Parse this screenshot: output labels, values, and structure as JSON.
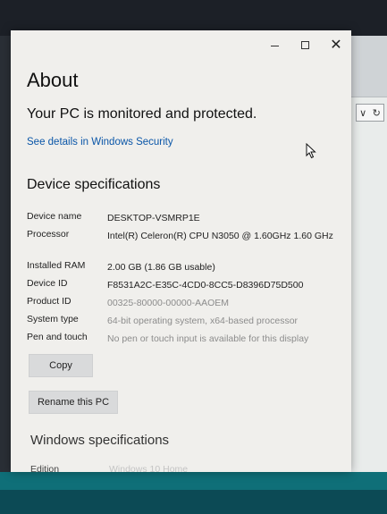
{
  "window": {
    "minimize_glyph": "",
    "maximize_glyph": "",
    "close_glyph": "✕"
  },
  "page_title": "About",
  "protection_status": "Your PC is monitored and protected.",
  "security_link": "See details in Windows Security",
  "device_specs": {
    "heading": "Device specifications",
    "rows": [
      {
        "label": "Device name",
        "value": "DESKTOP-VSMRP1E"
      },
      {
        "label": "Processor",
        "value": "Intel(R) Celeron(R) CPU  N3050  @ 1.60GHz   1.60 GHz"
      },
      {
        "label": "Installed RAM",
        "value": "2.00 GB (1.86 GB usable)"
      },
      {
        "label": "Device ID",
        "value": "F8531A2C-E35C-4CD0-8CC5-D8396D75D500"
      },
      {
        "label": "Product ID",
        "value": "00325-80000-00000-AAOEM"
      },
      {
        "label": "System type",
        "value": "64-bit operating system, x64-based processor"
      },
      {
        "label": "Pen and touch",
        "value": "No pen or touch input is available for this display"
      }
    ],
    "copy_button": "Copy",
    "rename_button": "Rename this PC"
  },
  "windows_specs": {
    "heading": "Windows specifications",
    "edition_label": "Edition",
    "edition_value": "Windows 10 Home"
  },
  "background_window": {
    "nav_left": "∨",
    "nav_right": "↻"
  },
  "colors": {
    "window_bg": "#f0efec",
    "link": "#0a56a8",
    "taskbar": "#0c4a55"
  }
}
